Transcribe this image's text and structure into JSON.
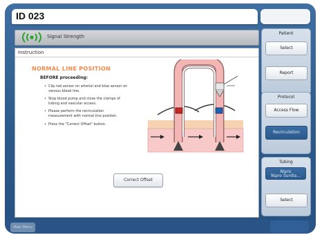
{
  "window": {
    "title": "ID 023"
  },
  "status": {
    "signal_label": "Signal Strength"
  },
  "instruction": {
    "header": "Instruction",
    "step_title": "NORMAL LINE POSITION",
    "subtitle": "BEFORE proceeding:",
    "bullets": [
      "Clip red sensor on arterial and blue sensor on venous blood line.",
      "Stop blood pump and close the clamps of tubing and vascular access.",
      "Please perform the recirculation measurement with normal line position.",
      "Press the \"Correct Offset\" button."
    ],
    "correct_offset_label": "Correct Offset"
  },
  "panels": {
    "patient": {
      "title": "Patient",
      "select_label": "Select",
      "report_label": "Report"
    },
    "protocol": {
      "title": "Protocol",
      "access_flow_label": "Access Flow",
      "recirculation_label": "Recirculation"
    },
    "tubing": {
      "title": "Tubing",
      "selected_line1": "Nipro",
      "selected_line2": "Nipro Surdia...",
      "select_label": "Select"
    }
  },
  "footer": {
    "main_menu_label": "Main Menu"
  },
  "colors": {
    "accent": "#2b5a8c",
    "step_title": "#f28a4d",
    "signal_icon": "#2fa12f",
    "arterial_clip": "#c62828",
    "venous_clip": "#1f5fb0",
    "tube": "#f4b5b5"
  }
}
